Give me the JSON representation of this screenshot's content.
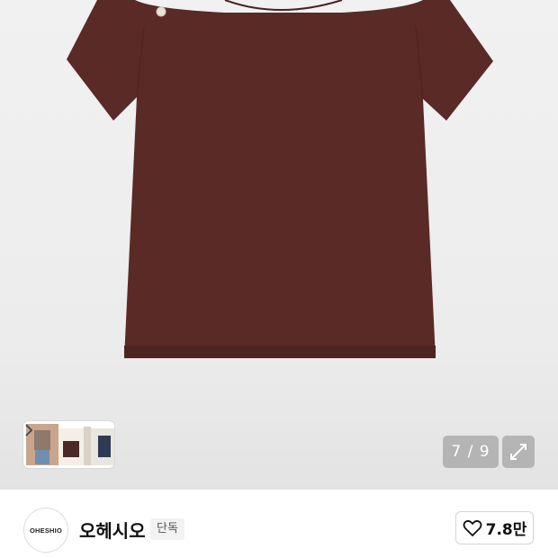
{
  "gallery": {
    "image_alt": "brown short-sleeve t-shirt",
    "counter": "7 / 9",
    "thumbnails": [
      "thumb-1",
      "thumb-2",
      "thumb-3"
    ],
    "expand_icon": "expand-icon",
    "next_icon": "chevron-right-icon"
  },
  "seller": {
    "logo_text": "OHESHIO",
    "name": "오헤시오",
    "badge": "단독"
  },
  "like": {
    "icon": "heart-icon",
    "count": "7.8만"
  },
  "colors": {
    "shirt": "#5a2a27",
    "shirt_shadow": "#4a2220",
    "background": "#eeeeee"
  }
}
